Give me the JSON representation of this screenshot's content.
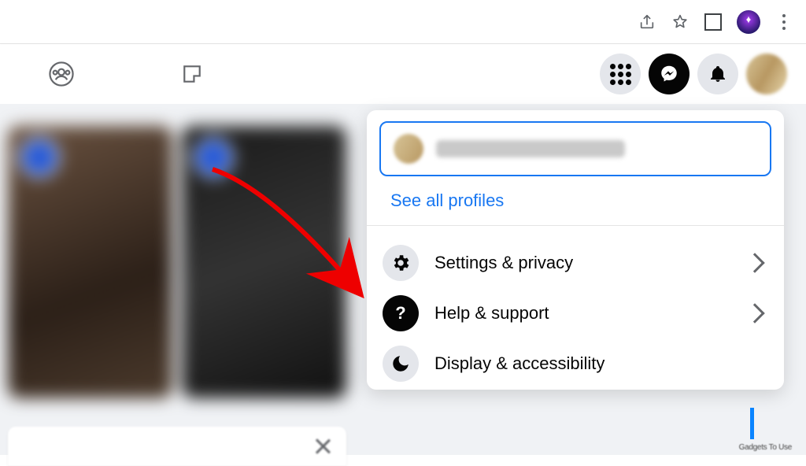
{
  "dropdown": {
    "see_all_profiles": "See all profiles",
    "items": [
      {
        "label": "Settings & privacy"
      },
      {
        "label": "Help & support"
      },
      {
        "label": "Display & accessibility"
      }
    ]
  },
  "watermark": "Gadgets To Use"
}
